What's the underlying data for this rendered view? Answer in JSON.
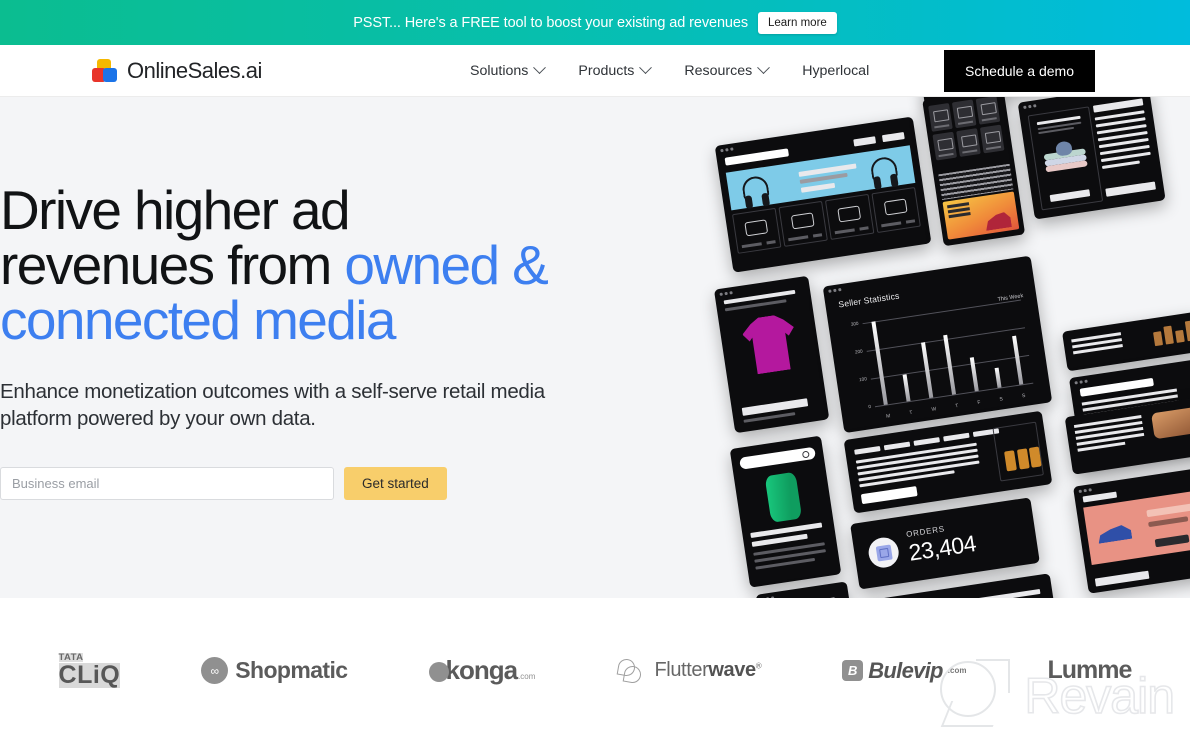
{
  "promo_banner": {
    "text": "PSST... Here's a FREE tool to boost your existing ad revenues",
    "button_label": "Learn more",
    "gradient_start": "#0bbd90",
    "gradient_end": "#00bcdd"
  },
  "header": {
    "brand_name": "OnlineSales.ai",
    "brand_colors": {
      "top": "#f5b800",
      "left": "#e8342a",
      "right": "#1a73e8"
    },
    "nav": [
      {
        "label": "Solutions",
        "has_dropdown": true
      },
      {
        "label": "Products",
        "has_dropdown": true
      },
      {
        "label": "Resources",
        "has_dropdown": true
      },
      {
        "label": "Hyperlocal",
        "has_dropdown": false
      }
    ],
    "cta_label": "Schedule a demo",
    "cta_bg": "#000000"
  },
  "hero": {
    "title_line1": "Drive higher ad",
    "title_line2_plain": "revenues from ",
    "title_line2_accent": "owned &",
    "title_line3_accent": "connected media",
    "accent_color": "#3d7ff0",
    "subtitle": "Enhance monetization outcomes with a self-serve retail media platform powered by your own data.",
    "email_placeholder": "Business email",
    "email_value": "",
    "submit_label": "Get started",
    "submit_bg": "#f8ce6b",
    "background": "#f4f5f7"
  },
  "collage": {
    "seller_stats": {
      "title": "Seller Statistics",
      "range_label": "This Week"
    },
    "orders_widget": {
      "label": "ORDERS",
      "value": "23,404",
      "icon": "cube-icon"
    }
  },
  "chart_data": {
    "type": "bar",
    "title": "Seller Statistics",
    "subtitle": "This Week",
    "categories": [
      "M",
      "T",
      "W",
      "T",
      "F",
      "S",
      "S"
    ],
    "values": [
      300,
      95,
      200,
      215,
      120,
      70,
      175
    ],
    "xlabel": "",
    "ylabel": "",
    "ylim": [
      0,
      300
    ],
    "yticks": [
      0,
      100,
      200,
      300
    ],
    "grid": true,
    "legend": "none"
  },
  "partner_logos": [
    {
      "name": "TATA CLiQ",
      "line1": "TATA",
      "line2": "CLiQ"
    },
    {
      "name": "Shopmatic",
      "text": "Shopmatic",
      "mark": "infinity-icon"
    },
    {
      "name": "konga.com",
      "text": "konga",
      "suffix": ".com"
    },
    {
      "name": "Flutterwave",
      "text_light": "Flutter",
      "text_bold": "wave",
      "reg": "®"
    },
    {
      "name": "Bulevip.com",
      "badge": "B",
      "text": "Bulevip",
      "suffix": ".com"
    },
    {
      "name": "Lumme",
      "text": "Lumme"
    }
  ],
  "watermark": {
    "text": "Revain",
    "mark": "revain-logo-icon"
  }
}
